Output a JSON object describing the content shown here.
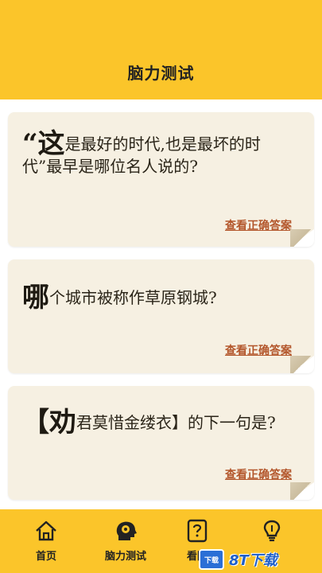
{
  "header": {
    "title": "脑力测试"
  },
  "cards": [
    {
      "lead": "“这",
      "rest": "是最好的时代,也是最坏的时代”最早是哪位名人说的?",
      "link": "查看正确答案"
    },
    {
      "lead": "哪",
      "rest": "个城市被称作草原钢城?",
      "link": "查看正确答案"
    },
    {
      "lead": "【劝",
      "rest": "君莫惜金缕衣】的下一句是?",
      "link": "查看正确答案"
    }
  ],
  "tabs": [
    {
      "label": "首页",
      "icon": "home-icon"
    },
    {
      "label": "脑力测试",
      "icon": "brain-head-icon"
    },
    {
      "label": "看图",
      "icon": "question-card-icon"
    },
    {
      "label": "",
      "icon": "lightbulb-icon"
    }
  ],
  "watermark": {
    "badge": "下载",
    "text": "8T下载"
  },
  "colors": {
    "accent": "#fbc52a",
    "card": "#f6f0e2",
    "link": "#b3562b"
  }
}
